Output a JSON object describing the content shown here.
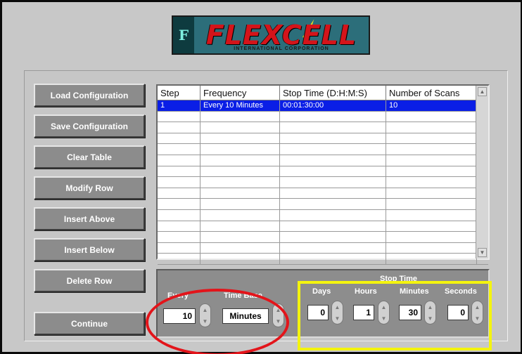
{
  "logo": {
    "mark": "F",
    "name": "FLEXCELL",
    "tagline": "INTERNATIONAL CORPORATION"
  },
  "buttons": {
    "load": "Load Configuration",
    "save": "Save Configuration",
    "clear": "Clear Table",
    "modify": "Modify Row",
    "insert_above": "Insert Above",
    "insert_below": "Insert Below",
    "delete": "Delete Row",
    "continue": "Continue"
  },
  "table": {
    "headers": [
      "Step",
      "Frequency",
      "Stop Time (D:H:M:S)",
      "Number of Scans"
    ],
    "rows": [
      {
        "step": "1",
        "frequency": "Every 10 Minutes",
        "stop_time": "00:01:30:00",
        "scans": "10"
      }
    ],
    "scroll_up": "▲",
    "scroll_down": "▼"
  },
  "schedule": {
    "every_label": "Every",
    "every_value": "10",
    "time_base_label": "Time Base",
    "time_base_value": "Minutes",
    "stop_time_title": "Stop Time",
    "days_label": "Days",
    "days_value": "0",
    "hours_label": "Hours",
    "hours_value": "1",
    "minutes_label": "Minutes",
    "minutes_value": "30",
    "seconds_label": "Seconds",
    "seconds_value": "0"
  },
  "colors": {
    "highlight_red": "#e3141a",
    "highlight_yellow": "#f4f40e",
    "selection": "#0a1ee6"
  }
}
